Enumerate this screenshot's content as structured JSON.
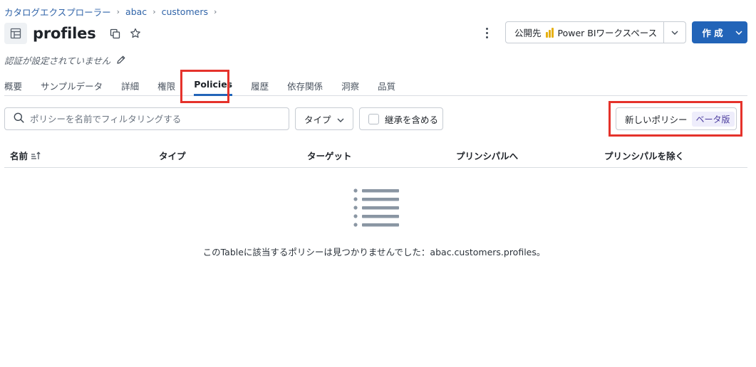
{
  "breadcrumb": {
    "items": [
      "カタログエクスプローラー",
      "abac",
      "customers"
    ],
    "separator": "›"
  },
  "header": {
    "title": "profiles",
    "publish_label": "公開先",
    "publish_target": "Power BIワークスペース",
    "create_label": "作 成"
  },
  "description": {
    "text": "認証が設定されていません"
  },
  "tabs": [
    {
      "label": "概要"
    },
    {
      "label": "サンプルデータ"
    },
    {
      "label": "詳細"
    },
    {
      "label": "権限"
    },
    {
      "label": "Policies",
      "active": true
    },
    {
      "label": "履歴"
    },
    {
      "label": "依存関係"
    },
    {
      "label": "洞察"
    },
    {
      "label": "品質"
    }
  ],
  "toolbar": {
    "search_placeholder": "ポリシーを名前でフィルタリングする",
    "type_filter_label": "タイプ",
    "inherit_label": "継承を含める",
    "new_policy_label": "新しいポリシー",
    "beta_badge": "ベータ版"
  },
  "table": {
    "columns": [
      "名前",
      "タイプ",
      "ターゲット",
      "プリンシパルへ",
      "プリンシパルを除く"
    ]
  },
  "empty_state": {
    "message": "このTableに該当するポリシーは見つかりませんでした：abac.customers.profiles。"
  },
  "colors": {
    "accent": "#2264b8",
    "link": "#2f63a8",
    "highlight": "#e5322b",
    "beta_bg": "#eeedfb",
    "empty_icon": "#8a96a3"
  }
}
